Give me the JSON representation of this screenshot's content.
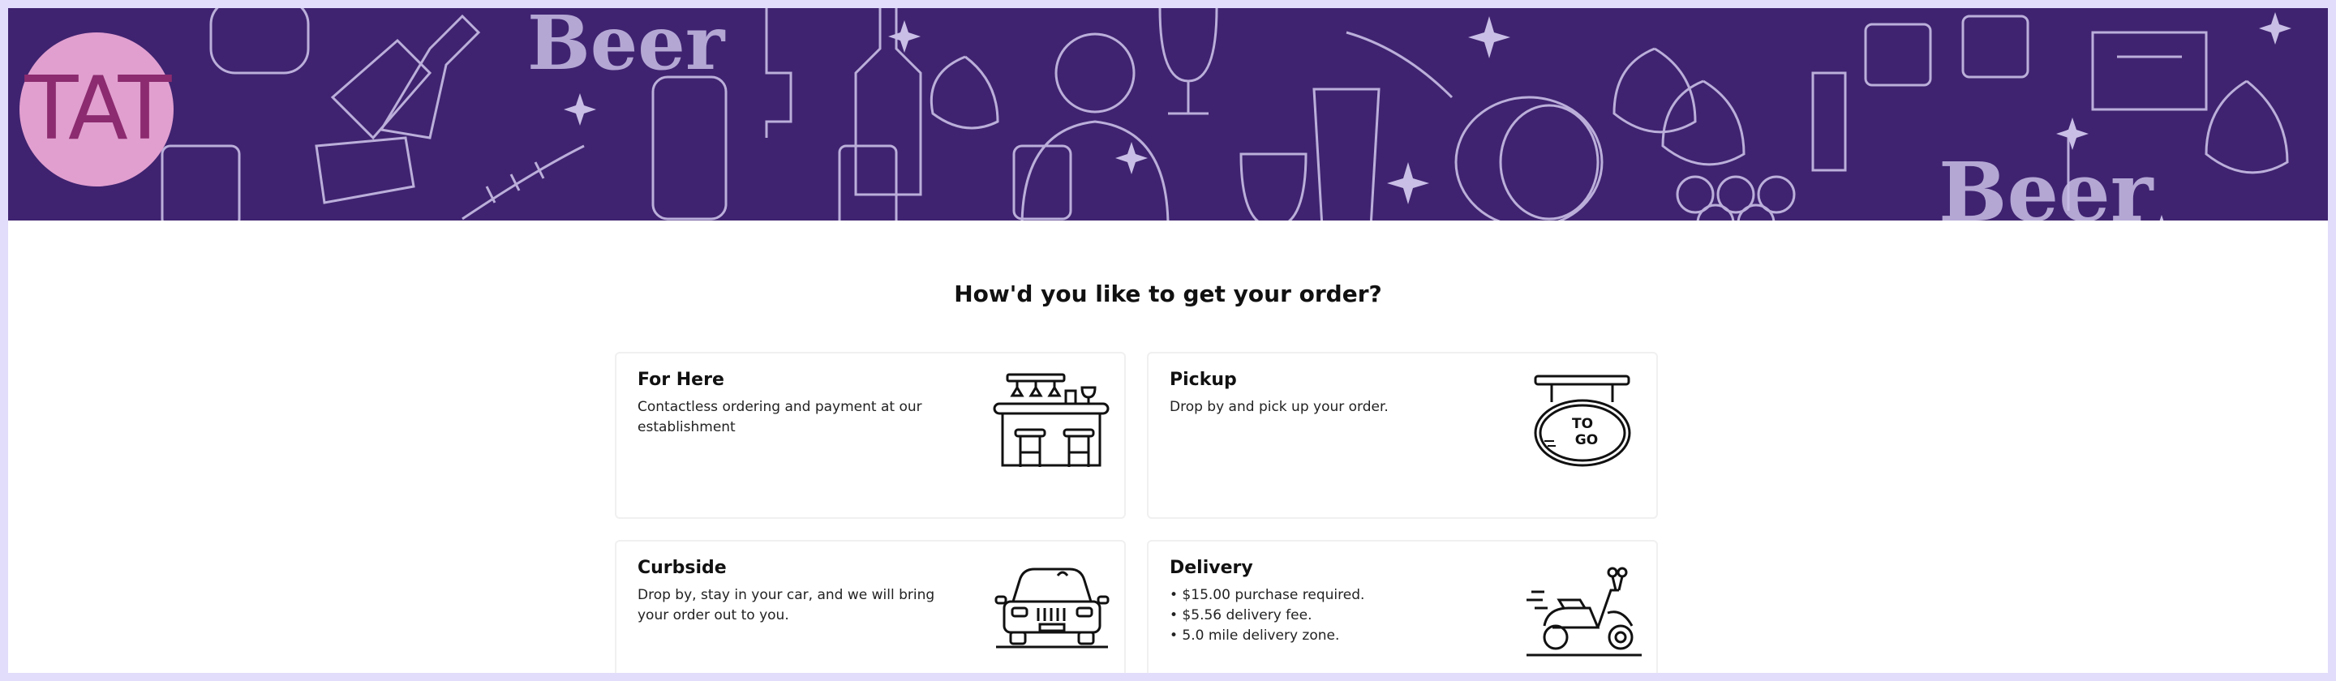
{
  "logo": {
    "text": "TAT"
  },
  "banner": {
    "words": [
      "Beer",
      "Beer"
    ]
  },
  "heading": "How'd you like to get your order?",
  "options": [
    {
      "title": "For Here",
      "description": "Contactless ordering and payment at our establishment",
      "icon": "bar-counter-icon"
    },
    {
      "title": "Pickup",
      "description": "Drop by and pick up your order.",
      "icon": "to-go-sign-icon",
      "icon_text": [
        "TO",
        "GO"
      ]
    },
    {
      "title": "Curbside",
      "description": "Drop by, stay in your car, and we will bring your order out to you.",
      "icon": "car-icon"
    },
    {
      "title": "Delivery",
      "bullets": [
        "• $15.00 purchase required.",
        "• $5.56 delivery fee.",
        "• 5.0 mile delivery zone."
      ],
      "icon": "scooter-icon"
    }
  ],
  "colors": {
    "banner": "#3f2370",
    "logo_bg": "#e19fcf",
    "logo_text": "#8c2b6f",
    "page_frame": "#e2ddfb"
  }
}
